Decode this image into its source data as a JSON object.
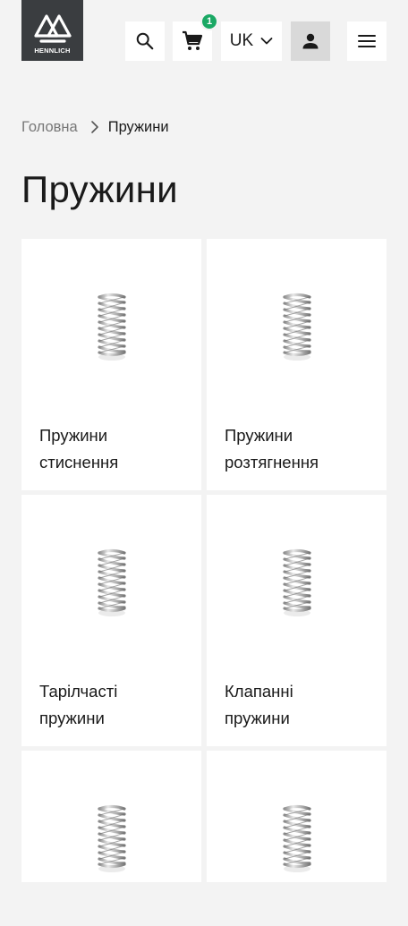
{
  "header": {
    "logo_text": "HENNLICH",
    "search_icon": "search-icon",
    "cart_icon": "cart-icon",
    "cart_count": "1",
    "language": "UK",
    "user_icon": "user-icon",
    "menu_icon": "hamburger-menu-icon",
    "badge_color": "#1aa864"
  },
  "breadcrumb": {
    "home": "Головна",
    "current": "Пружини"
  },
  "page": {
    "title": "Пружини"
  },
  "categories": [
    {
      "label_line1": "Пружини",
      "label_line2": "стиснення",
      "image_icon": "coil-spring-image"
    },
    {
      "label_line1": "Пружини",
      "label_line2": "розтягнення",
      "image_icon": "coil-spring-image"
    },
    {
      "label_line1": "Тарілчасті",
      "label_line2": "пружини",
      "image_icon": "coil-spring-image"
    },
    {
      "label_line1": "Клапанні",
      "label_line2": "пружини",
      "image_icon": "coil-spring-image"
    },
    {
      "label_line1": "",
      "label_line2": "",
      "image_icon": "coil-spring-image"
    },
    {
      "label_line1": "",
      "label_line2": "",
      "image_icon": "coil-spring-image"
    }
  ]
}
